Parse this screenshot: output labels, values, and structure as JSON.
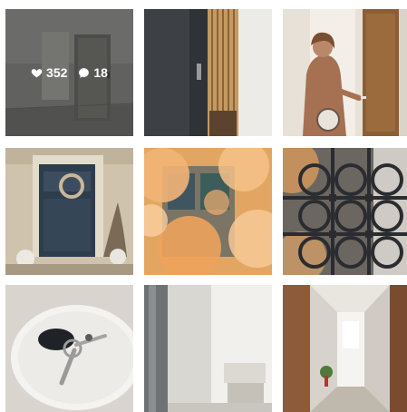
{
  "feed": {
    "posts": [
      {
        "likes": "352",
        "comments": "18",
        "hovered": true
      },
      {},
      {},
      {},
      {},
      {},
      {},
      {},
      {}
    ]
  },
  "icons": {
    "like": "heart-icon",
    "comment": "comment-bubble-icon"
  },
  "colors": {
    "overlay_text": "#ffffff"
  }
}
